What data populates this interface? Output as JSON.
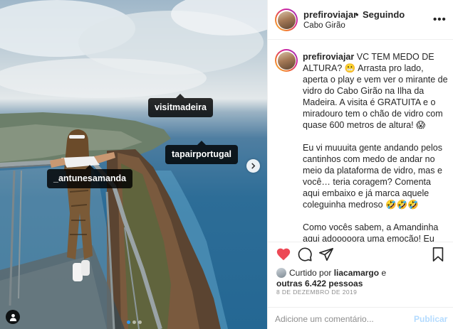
{
  "post": {
    "username": "prefiroviajar",
    "separator": "•",
    "follow_status": "Seguindo",
    "location": "Cabo Girão",
    "more_label": "•••"
  },
  "photo": {
    "tags": [
      "visitmadeira",
      "tapairportugal",
      "_antunesamanda"
    ],
    "carousel_total": 3,
    "carousel_active": 1
  },
  "caption": {
    "username": "prefiroviajar",
    "paragraph1": "VC TEM MEDO DE ALTURA? 😬 Arrasta pro lado, aperta o play e vem ver o mirante de vidro do Cabo Girão na Ilha da Madeira. A visita é GRATUITA e o miradouro tem o chão de vidro com quase 600 metros de altura! 😱",
    "paragraph2": "Eu vi muuuita gente andando pelos cantinhos com medo de andar no meio da plataforma de vidro, mas e você… teria coragem? Comenta aqui embaixo e já marca aquele coleguinha medroso 🤣🤣🤣",
    "paragraph3": "Como vocês sabem, a Amandinha aqui adooooora uma emoção! Eu não só andei, como eu PULEI pra ver se era de boa mesmo hahahaha A cara"
  },
  "likes": {
    "prefix": "Curtido por",
    "user": "liacamargo",
    "joiner": "e",
    "others": "outras 6.422 pessoas"
  },
  "date": "8 DE DEZEMBRO DE 2019",
  "comment": {
    "placeholder": "Adicione um comentário...",
    "post_label": "Publicar"
  },
  "icons": [
    "heart-icon",
    "comment-icon",
    "share-icon",
    "bookmark-icon",
    "chevron-right-icon",
    "user-tag-icon",
    "more-icon"
  ],
  "colors": {
    "heart": "#ed4956",
    "post_disabled": "#b3dbff",
    "carousel_active": "#2d95f0",
    "date_grey": "#8e8e8e"
  }
}
